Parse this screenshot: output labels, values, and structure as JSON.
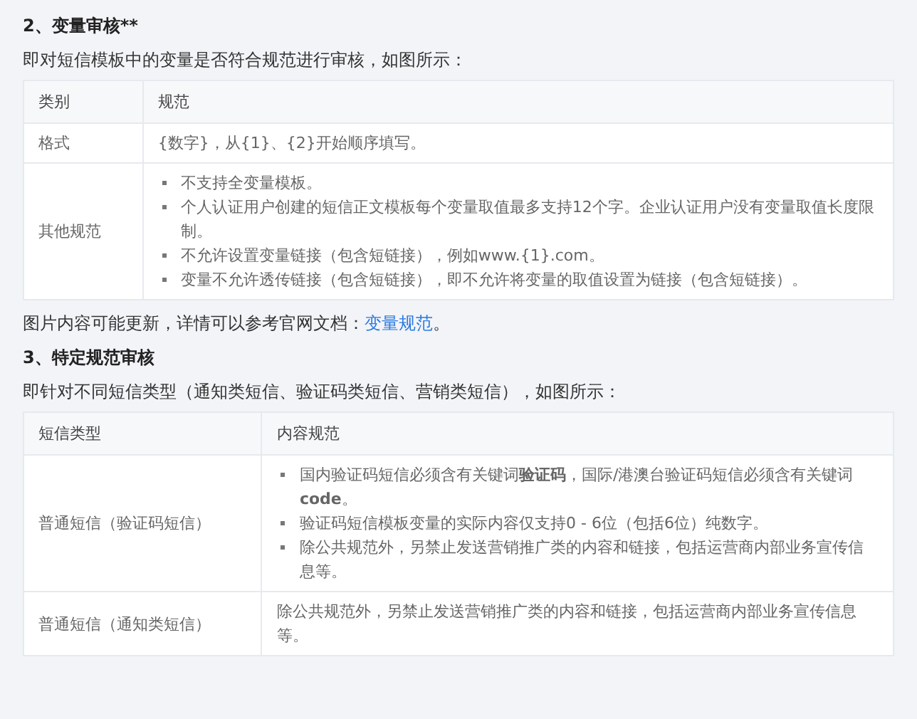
{
  "sections": [
    {
      "heading": "2、变量审核**",
      "intro": "即对短信模板中的变量是否符合规范进行审核，如图所示：",
      "table": {
        "columns": [
          "类别",
          "规范"
        ],
        "rows": [
          {
            "label": "格式",
            "text": "{数字}，从{1}、{2}开始顺序填写。"
          },
          {
            "label": "其他规范",
            "bullets": [
              "不支持全变量模板。",
              "个人认证用户创建的短信正文模板每个变量取值最多支持12个字。企业认证用户没有变量取值长度限制。",
              "不允许设置变量链接（包含短链接），例如www.{1}.com。",
              "变量不允许透传链接（包含短链接），即不允许将变量的取值设置为链接（包含短链接）。"
            ]
          }
        ]
      },
      "note": {
        "text": "图片内容可能更新，详情可以参考官网文档：",
        "link": "变量规范",
        "after": "。"
      }
    },
    {
      "heading": "3、特定规范审核",
      "intro": "即针对不同短信类型（通知类短信、验证码类短信、营销类短信），如图所示：",
      "table": {
        "columns": [
          "短信类型",
          "内容规范"
        ],
        "rows": [
          {
            "label": "普通短信（验证码短信）",
            "bullets": [
              "国内验证码短信必须含有关键词**验证码**，国际/港澳台验证码短信必须含有关键词 **code**。",
              "验证码短信模板变量的实际内容仅支持0 - 6位（包括6位）纯数字。",
              "除公共规范外，另禁止发送营销推广类的内容和链接，包括运营商内部业务宣传信息等。"
            ]
          },
          {
            "label": "普通短信（通知类短信）",
            "text": "除公共规范外，另禁止发送营销推广类的内容和链接，包括运营商内部业务宣传信息等。"
          }
        ]
      }
    }
  ]
}
